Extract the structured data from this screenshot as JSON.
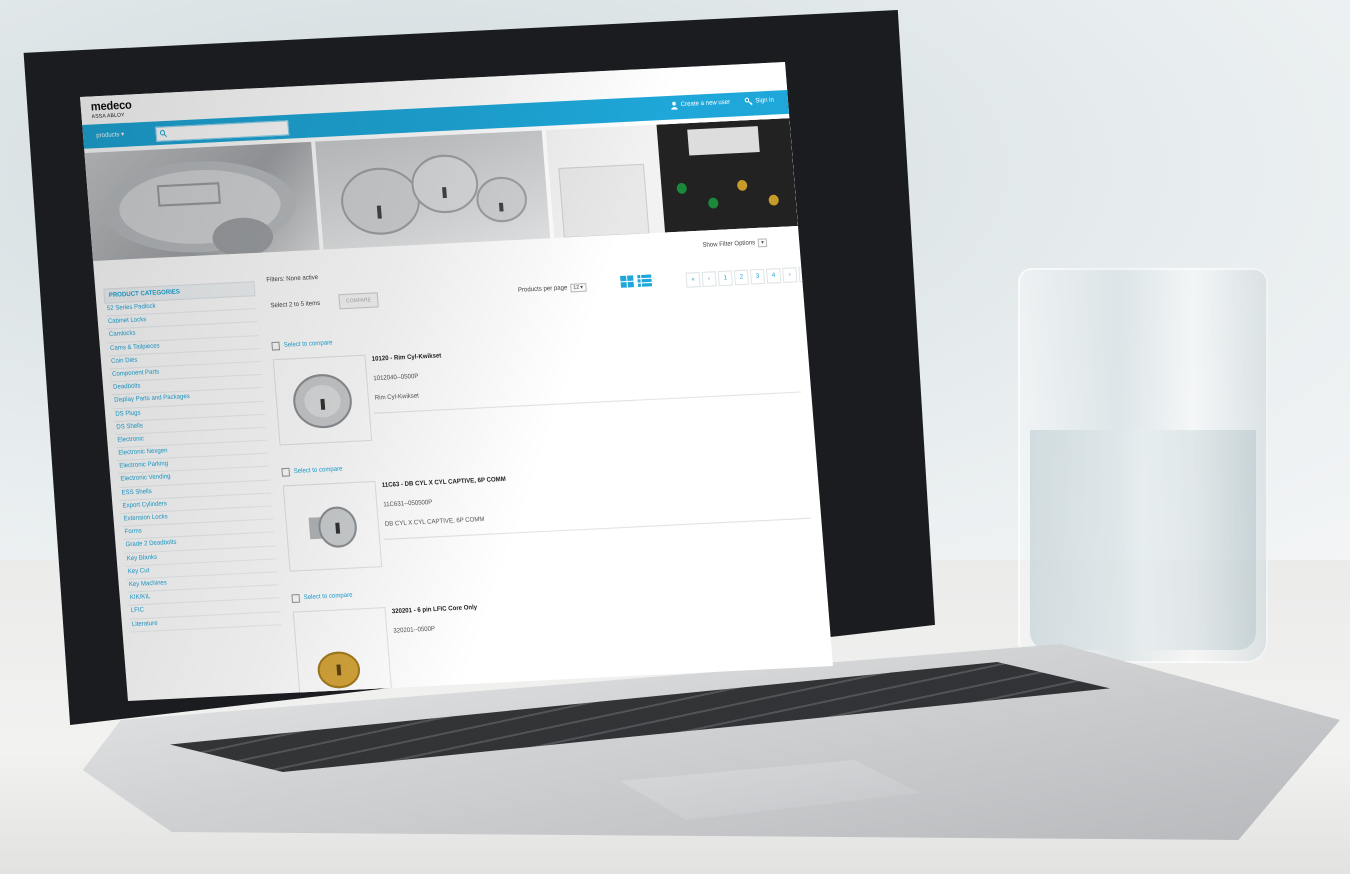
{
  "brand": {
    "name": "medeco",
    "sub": "ASSA ABLOY"
  },
  "top_bar": {
    "create_user": "Create a new user",
    "sign_in": "Sign in"
  },
  "nav": {
    "products_label": "products ▾",
    "search_placeholder": ""
  },
  "hero": {
    "slides": [
      "Medeco cylinder lock",
      "Medeco X4 cylinders",
      "Electronic key cabinet"
    ]
  },
  "filter_options": {
    "label": "Show Filter Options",
    "toggle": "▾"
  },
  "sidebar": {
    "header": "PRODUCT CATEGORIES",
    "items": [
      "52 Series Padlock",
      "Cabinet Locks",
      "Camlocks",
      "Cams & Tailpieces",
      "Coin Dies",
      "Component Parts",
      "Deadbolts",
      "Display Parts and Packages",
      "DS Plugs",
      "DS Shells",
      "Electronic",
      "Electronic Nexgen",
      "Electronic Parking",
      "Electronic Vending",
      "ESS Shells",
      "Export Cylinders",
      "Extension Locks",
      "Forms",
      "Grade 2 Deadbolts",
      "Key Blanks",
      "Key Cut",
      "Key Machines",
      "KIK/KIL",
      "LFIC",
      "Literature"
    ]
  },
  "toolbar": {
    "filters": "Filters: None active",
    "select_hint": "Select 2 to 5 items",
    "compare": "COMPARE",
    "per_page_label": "Products per page",
    "per_page_value": "12 ▾",
    "pages": [
      "«",
      "‹",
      "1",
      "2",
      "3",
      "4",
      "›",
      "»"
    ]
  },
  "products": [
    {
      "compare": "Select to compare",
      "title": "10120 - Rim Cyl-Kwikset",
      "sku": "1012040--0500P",
      "desc": "Rim Cyl-Kwikset"
    },
    {
      "compare": "Select to compare",
      "title": "11C63 - DB CYL X CYL CAPTIVE, 6P COMM",
      "sku": "11C631--050500P",
      "desc": "DB CYL X CYL CAPTIVE, 6P COMM"
    },
    {
      "compare": "Select to compare",
      "title": "320201 - 6 pin LFIC Core Only",
      "sku": "320201--0500P",
      "desc": ""
    }
  ],
  "colors": {
    "accent": "#1ea7d8",
    "bezel": "#1a1c1f"
  }
}
